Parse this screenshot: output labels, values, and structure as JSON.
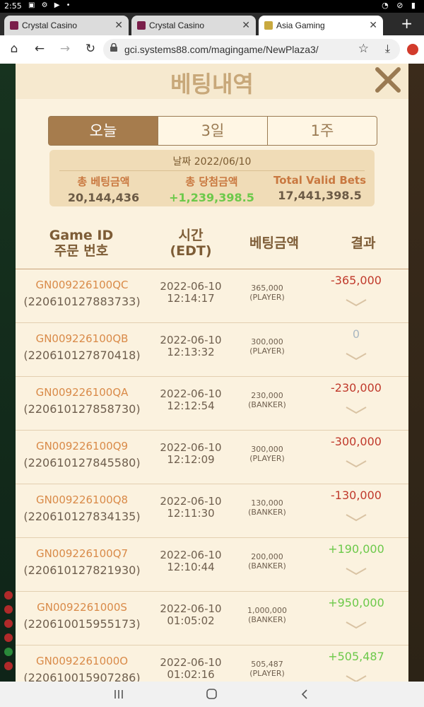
{
  "status": {
    "time": "2:55"
  },
  "browser": {
    "tabs": [
      {
        "title": "Crystal Casino"
      },
      {
        "title": "Crystal Casino"
      },
      {
        "title": "Asia Gaming"
      }
    ],
    "url": "gci.systems88.com/magingame/NewPlaza3/"
  },
  "modal": {
    "title": "베팅내역",
    "tabs": [
      "오늘",
      "3일",
      "1주"
    ],
    "summary": {
      "date": "날짜 2022/06/10",
      "total_bet_label": "총 베팅금액",
      "total_bet": "20,144,436",
      "total_win_label": "총 당첨금액",
      "total_win": "+1,239,398.5",
      "valid_bets_label": "Total Valid Bets",
      "valid_bets": "17,441,398.5"
    },
    "headers": {
      "game_id": "Game ID",
      "order_no": "주문 번호",
      "time": "시간",
      "time_tz": "(EDT)",
      "bet": "베팅금액",
      "result": "결과"
    },
    "rows": [
      {
        "game_id": "GN009226100QC",
        "order": "(220610127883733)",
        "date": "2022-06-10",
        "time": "12:14:17",
        "amount": "365,000",
        "side": "(PLAYER)",
        "result": "-365,000",
        "result_type": "neg"
      },
      {
        "game_id": "GN009226100QB",
        "order": "(220610127870418)",
        "date": "2022-06-10",
        "time": "12:13:32",
        "amount": "300,000",
        "side": "(PLAYER)",
        "result": "0",
        "result_type": "zero"
      },
      {
        "game_id": "GN009226100QA",
        "order": "(220610127858730)",
        "date": "2022-06-10",
        "time": "12:12:54",
        "amount": "230,000",
        "side": "(BANKER)",
        "result": "-230,000",
        "result_type": "neg"
      },
      {
        "game_id": "GN009226100Q9",
        "order": "(220610127845580)",
        "date": "2022-06-10",
        "time": "12:12:09",
        "amount": "300,000",
        "side": "(PLAYER)",
        "result": "-300,000",
        "result_type": "neg"
      },
      {
        "game_id": "GN009226100Q8",
        "order": "(220610127834135)",
        "date": "2022-06-10",
        "time": "12:11:30",
        "amount": "130,000",
        "side": "(BANKER)",
        "result": "-130,000",
        "result_type": "neg"
      },
      {
        "game_id": "GN009226100Q7",
        "order": "(220610127821930)",
        "date": "2022-06-10",
        "time": "12:10:44",
        "amount": "200,000",
        "side": "(BANKER)",
        "result": "+190,000",
        "result_type": "pos"
      },
      {
        "game_id": "GN0092261000S",
        "order": "(220610015955173)",
        "date": "2022-06-10",
        "time": "01:05:02",
        "amount": "1,000,000",
        "side": "(BANKER)",
        "result": "+950,000",
        "result_type": "pos"
      },
      {
        "game_id": "GN0092261000O",
        "order": "(220610015907286)",
        "date": "2022-06-10",
        "time": "01:02:16",
        "amount": "505,487",
        "side": "(PLAYER)",
        "result": "+505,487",
        "result_type": "pos"
      }
    ]
  }
}
